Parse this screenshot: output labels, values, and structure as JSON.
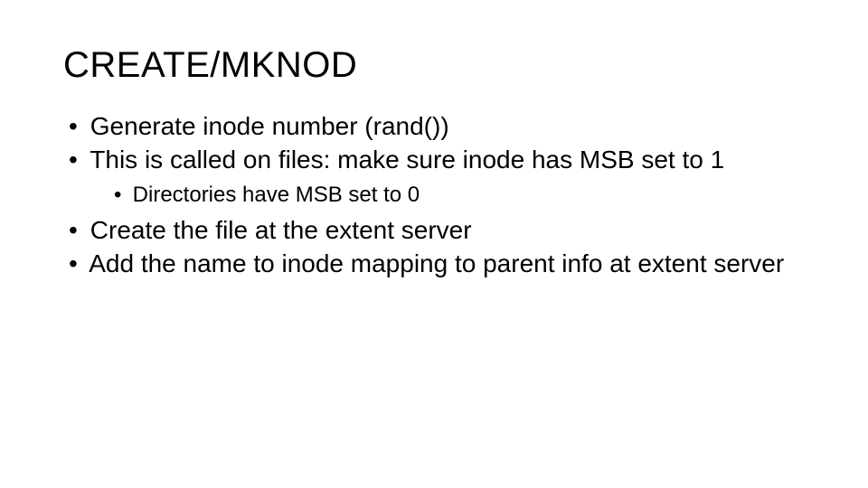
{
  "slide": {
    "title": "CREATE/MKNOD",
    "bullets": [
      {
        "text": "Generate inode number (rand())"
      },
      {
        "text": "This is called on files: make sure inode has MSB set to 1",
        "sub": [
          {
            "text": "Directories have MSB set to 0"
          }
        ]
      },
      {
        "text": "Create the file at the extent server"
      },
      {
        "text": "Add the name to inode mapping to parent info at extent server"
      }
    ]
  }
}
